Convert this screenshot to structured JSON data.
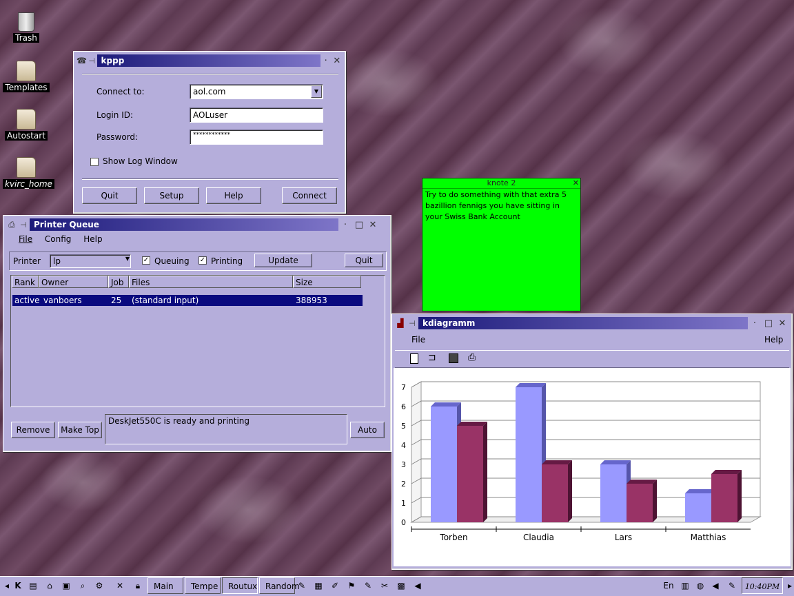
{
  "desktop": {
    "icons": [
      {
        "label": "Trash",
        "icon": "trash-icon"
      },
      {
        "label": "Templates",
        "icon": "folder-icon"
      },
      {
        "label": "Autostart",
        "icon": "folder-icon"
      },
      {
        "label": "kvirc_home",
        "icon": "folder-link-icon"
      }
    ]
  },
  "kppp": {
    "title": "kppp",
    "connect_to_label": "Connect to:",
    "connect_to_value": "aol.com",
    "login_label": "Login ID:",
    "login_value": "AOLuser",
    "password_label": "Password:",
    "password_value": "************",
    "show_log_label": "Show Log Window",
    "show_log_checked": false,
    "buttons": {
      "quit": "Quit",
      "setup": "Setup",
      "help": "Help",
      "connect": "Connect"
    }
  },
  "knote": {
    "title": "knote 2",
    "text": "Try to do something with that extra 5 bazillion fennigs you have sitting in your Swiss Bank Account",
    "color": "#00ff00"
  },
  "printer_queue": {
    "title": "Printer Queue",
    "menu": [
      "File",
      "Config",
      "Help"
    ],
    "printer_label": "Printer",
    "printer_value": "lp",
    "queuing_label": "Queuing",
    "queuing_checked": true,
    "printing_label": "Printing",
    "printing_checked": true,
    "update_button": "Update",
    "quit_button": "Quit",
    "columns": [
      "Rank",
      "Owner",
      "Job",
      "Files",
      "Size"
    ],
    "rows": [
      {
        "rank": "active",
        "owner": "vanboers",
        "job": "25",
        "files": "(standard input)",
        "size": "388953"
      }
    ],
    "remove_button": "Remove",
    "maketop_button": "Make Top",
    "status_text": "DeskJet550C is ready and printing",
    "auto_button": "Auto"
  },
  "kdiagramm": {
    "title": "kdiagramm",
    "menu_file": "File",
    "menu_help": "Help",
    "toolbar": [
      "new-file-icon",
      "open-folder-icon",
      "save-icon",
      "print-icon"
    ]
  },
  "chart_data": {
    "type": "bar",
    "categories": [
      "Torben",
      "Claudia",
      "Lars",
      "Matthias"
    ],
    "series": [
      {
        "values": [
          6,
          7,
          3,
          1.5
        ],
        "color": "#9999ff"
      },
      {
        "values": [
          5,
          3,
          2,
          2.5
        ],
        "color": "#993366"
      }
    ],
    "ylim": [
      0,
      7
    ],
    "yticks": [
      "0",
      "1",
      "2",
      "3",
      "4",
      "5",
      "6",
      "7"
    ],
    "grid": true,
    "three_d": true
  },
  "taskbar": {
    "tasks": [
      "Main",
      "Tempe",
      "Routux",
      "Random"
    ],
    "language": "En",
    "clock": "10:40PM"
  }
}
